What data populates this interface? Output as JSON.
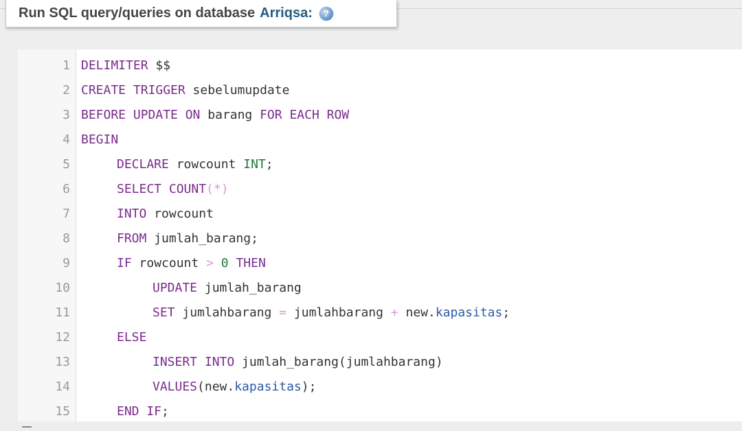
{
  "header": {
    "title": "Run SQL query/queries on database",
    "database": "Arriqsa:",
    "help_icon_glyph": "?"
  },
  "editor": {
    "lines": [
      {
        "n": "1",
        "indent": 0,
        "tokens": [
          [
            "kw",
            "DELIMITER"
          ],
          [
            "txt",
            " $$"
          ]
        ]
      },
      {
        "n": "2",
        "indent": 0,
        "tokens": [
          [
            "kw",
            "CREATE TRIGGER"
          ],
          [
            "txt",
            " sebelumupdate"
          ]
        ]
      },
      {
        "n": "3",
        "indent": 0,
        "tokens": [
          [
            "kw",
            "BEFORE UPDATE ON"
          ],
          [
            "txt",
            " barang "
          ],
          [
            "kw",
            "FOR EACH ROW"
          ]
        ]
      },
      {
        "n": "4",
        "indent": 0,
        "tokens": [
          [
            "kw",
            "BEGIN"
          ]
        ]
      },
      {
        "n": "5",
        "indent": 1,
        "tokens": [
          [
            "kw",
            "DECLARE"
          ],
          [
            "txt",
            " rowcount "
          ],
          [
            "num",
            "INT"
          ],
          [
            "txt",
            ";"
          ]
        ]
      },
      {
        "n": "6",
        "indent": 1,
        "tokens": [
          [
            "kw",
            "SELECT COUNT"
          ],
          [
            "op",
            "(*)"
          ]
        ]
      },
      {
        "n": "7",
        "indent": 1,
        "tokens": [
          [
            "kw",
            "INTO"
          ],
          [
            "txt",
            " rowcount"
          ]
        ]
      },
      {
        "n": "8",
        "indent": 1,
        "tokens": [
          [
            "kw",
            "FROM"
          ],
          [
            "txt",
            " jumlah_barang;"
          ]
        ]
      },
      {
        "n": "9",
        "indent": 1,
        "tokens": [
          [
            "kw",
            "IF"
          ],
          [
            "txt",
            " rowcount "
          ],
          [
            "op",
            ">"
          ],
          [
            "txt",
            " "
          ],
          [
            "num",
            "0"
          ],
          [
            "txt",
            " "
          ],
          [
            "kw",
            "THEN"
          ]
        ]
      },
      {
        "n": "10",
        "indent": 2,
        "tokens": [
          [
            "kw",
            "UPDATE"
          ],
          [
            "txt",
            " jumlah_barang"
          ]
        ]
      },
      {
        "n": "11",
        "indent": 2,
        "tokens": [
          [
            "kw",
            "SET"
          ],
          [
            "txt",
            " jumlahbarang "
          ],
          [
            "op",
            "="
          ],
          [
            "txt",
            " jumlahbarang "
          ],
          [
            "op",
            "+"
          ],
          [
            "txt",
            " new."
          ],
          [
            "prop",
            "kapasitas"
          ],
          [
            "txt",
            ";"
          ]
        ]
      },
      {
        "n": "12",
        "indent": 1,
        "tokens": [
          [
            "kw",
            "ELSE"
          ]
        ]
      },
      {
        "n": "13",
        "indent": 2,
        "tokens": [
          [
            "kw",
            "INSERT INTO"
          ],
          [
            "txt",
            " jumlah_barang(jumlahbarang)"
          ]
        ]
      },
      {
        "n": "14",
        "indent": 2,
        "tokens": [
          [
            "kw",
            "VALUES"
          ],
          [
            "txt",
            "(new."
          ],
          [
            "prop",
            "kapasitas"
          ],
          [
            "txt",
            ");"
          ]
        ]
      },
      {
        "n": "15",
        "indent": 1,
        "tokens": [
          [
            "kw",
            "END IF"
          ],
          [
            "txt",
            ";"
          ]
        ]
      }
    ]
  }
}
